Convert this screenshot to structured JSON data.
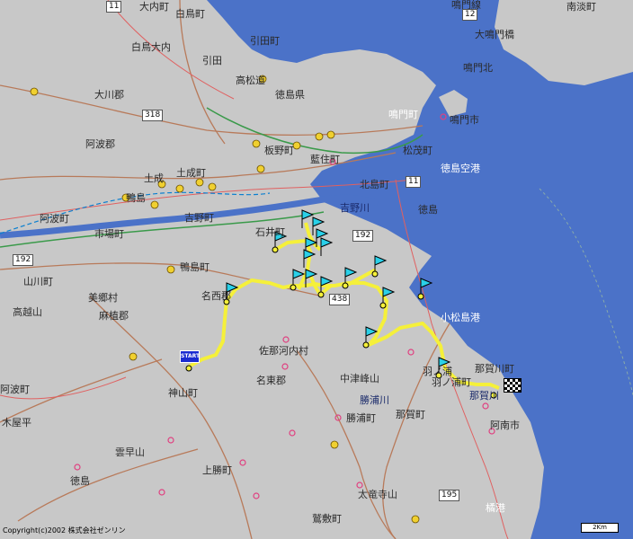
{
  "map": {
    "copyright": "Copyright(c)2002 株式会社ゼンリン",
    "scale_label": "2Km",
    "start_label": "START",
    "route_color": "#f5f03a",
    "sea_color": "#4b72c8",
    "land_color": "#c8c8c8",
    "flag_color": "#2ad0e8",
    "place_labels": [
      "大内町",
      "白鳥町",
      "白鳥大内",
      "引田",
      "引田町",
      "高松道",
      "徳島県",
      "大川郡",
      "阿波郡",
      "土成",
      "土成町",
      "鴨島",
      "吉野町",
      "市場町",
      "阿波町",
      "藍住町",
      "松茂町",
      "北島町",
      "板野町",
      "鳴門町",
      "鳴門市",
      "徳島",
      "徳島空港",
      "鴨島町",
      "名西郡",
      "美郷村",
      "麻植郡",
      "山川町",
      "高越山",
      "神山町",
      "佐那河内村",
      "名東郡",
      "中津峰山",
      "小松島港",
      "那賀川町",
      "阿南市",
      "羽ノ浦町",
      "勝浦町",
      "勝浦川",
      "上勝町",
      "那賀町",
      "鷲敷町",
      "太竜寺山",
      "木屋平",
      "雲早山",
      "徳島",
      "橘港",
      "鳴門北",
      "大鳴門橋",
      "南淡町",
      "鳴門線",
      "吉野川",
      "石井町",
      "羽ノ浦",
      "阿波町",
      "那賀川"
    ],
    "route_shields": [
      "11",
      "318",
      "192",
      "192",
      "11",
      "438",
      "195",
      "12"
    ]
  }
}
